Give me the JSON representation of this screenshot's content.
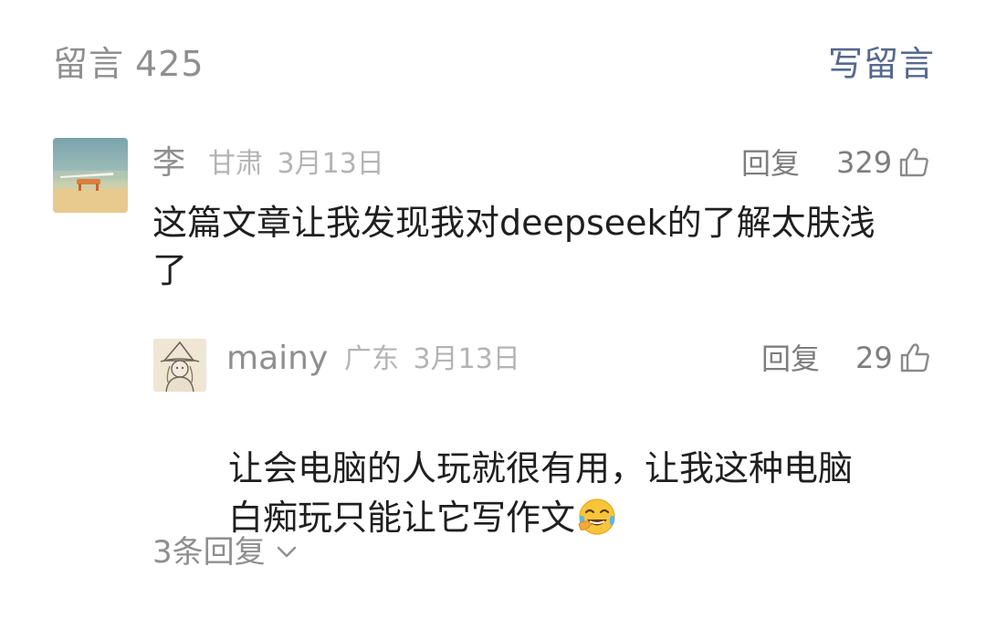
{
  "header": {
    "title": "留言",
    "count": "425",
    "write_label": "写留言"
  },
  "comments": [
    {
      "name": "李",
      "location": "甘肃",
      "date": "3月13日",
      "reply_label": "回复",
      "likes": "329",
      "content": "这篇文章让我发现我对deepseek的了解太肤浅\n了",
      "replies": [
        {
          "name": "mainy",
          "location": "广东",
          "date": "3月13日",
          "reply_label": "回复",
          "likes": "29",
          "content": "让会电脑的人玩就很有用，让我这种电脑\n白痴玩只能让它写作文",
          "emoji": "face-with-tears-of-joy"
        }
      ],
      "more_replies_label": "3条回复"
    }
  ],
  "icons": {
    "like": "thumbs-up-icon",
    "expand": "chevron-down-icon"
  },
  "colors": {
    "link": "#56688f",
    "muted": "#8f8f8f",
    "text": "#1f1f1f"
  }
}
